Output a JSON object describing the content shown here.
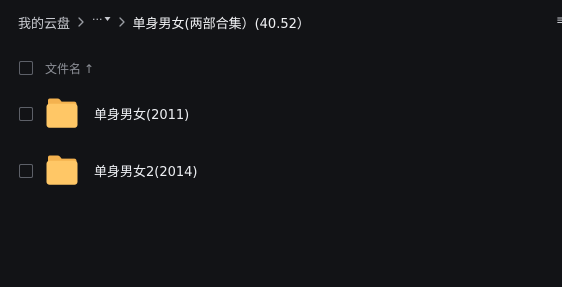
{
  "breadcrumb": {
    "root_label": "我的云盘",
    "more_label": "···",
    "current_label": "单身男女(两部合集）(40.52）",
    "edge_fragment": "≡"
  },
  "list": {
    "header": {
      "name_column_label": "文件名",
      "sort_indicator": "↑"
    },
    "items": [
      {
        "label": "单身男女(2011)",
        "icon": "folder-icon"
      },
      {
        "label": "单身男女2(2014)",
        "icon": "folder-icon"
      }
    ]
  },
  "colors": {
    "background": "#121316",
    "folder": "#ffc766",
    "text": "#eceef2",
    "muted_text": "#8c8f96"
  }
}
